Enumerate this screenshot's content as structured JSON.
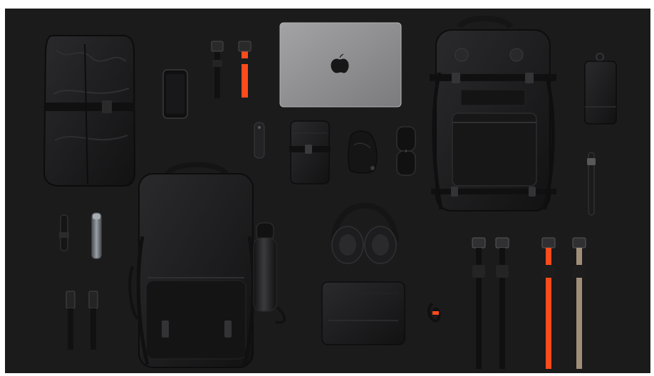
{
  "photo": {
    "subject": "flat-lay-travel-gear",
    "colors": {
      "background": "#1b1b1c",
      "bag": "#161617",
      "bag_highlight": "#2b2b2d",
      "laptop": "#8e8e90",
      "strap_orange": "#ff4a1c",
      "strap_tan": "#a08f78",
      "metal": "#7f8388"
    },
    "items": [
      "packable-duffel",
      "smartphone",
      "webbing-straps",
      "laptop",
      "large-backpack",
      "small-pouch",
      "pocket-knife",
      "toiletry-roll",
      "stuff-sack",
      "sunglasses",
      "pen",
      "daypack",
      "carabiners",
      "flashlight",
      "water-bottle",
      "headphones",
      "tech-pouch",
      "cable-organizer",
      "compression-straps"
    ]
  }
}
